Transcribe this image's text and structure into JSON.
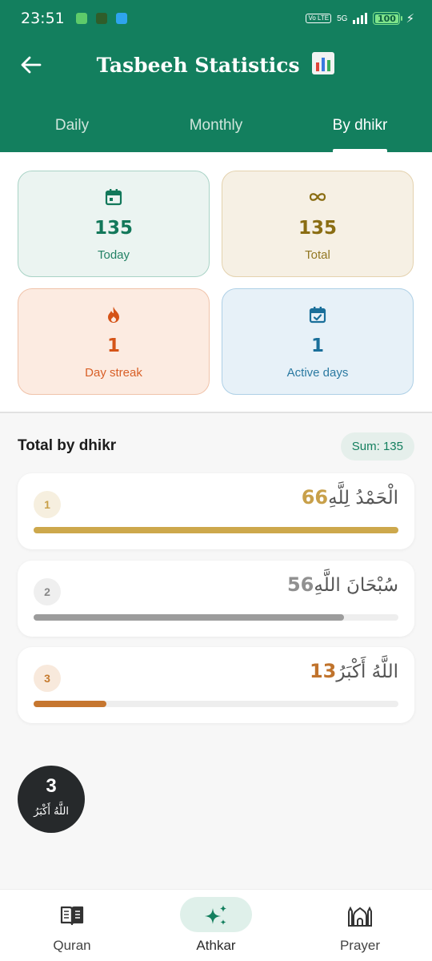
{
  "status_bar": {
    "time": "23:51",
    "volte": "Vo LTE",
    "network": "5G",
    "battery": "100"
  },
  "header": {
    "title": "Tasbeeh Statistics"
  },
  "tabs": [
    {
      "label": "Daily",
      "active": false
    },
    {
      "label": "Monthly",
      "active": false
    },
    {
      "label": "By dhikr",
      "active": true
    }
  ],
  "stats": {
    "today": {
      "value": "135",
      "label": "Today"
    },
    "total": {
      "value": "135",
      "label": "Total"
    },
    "streak": {
      "value": "1",
      "label": "Day streak"
    },
    "active_days": {
      "value": "1",
      "label": "Active days"
    }
  },
  "section": {
    "title": "Total by dhikr",
    "sum": "Sum: 135"
  },
  "dhikr_list": [
    {
      "rank": "1",
      "count": "66",
      "text": "الْحَمْدُ لِلَّهِ",
      "progress": 1.0
    },
    {
      "rank": "2",
      "count": "56",
      "text": "سُبْحَانَ اللَّهِ",
      "progress": 0.85
    },
    {
      "rank": "3",
      "count": "13",
      "text": "اللَّهُ أَكْبَرُ",
      "progress": 0.2
    }
  ],
  "fab": {
    "count": "3",
    "label": "اللَّهُ أَكْبَرُ"
  },
  "bottom_nav": [
    {
      "label": "Quran",
      "icon": "book-icon",
      "active": false
    },
    {
      "label": "Athkar",
      "icon": "sparkle-icon",
      "active": true
    },
    {
      "label": "Prayer",
      "icon": "mosque-icon",
      "active": false
    }
  ],
  "colors": {
    "brand": "#137f5e",
    "gold": "#cda84c",
    "silver": "#9c9c9c",
    "bronze": "#c6762f"
  }
}
